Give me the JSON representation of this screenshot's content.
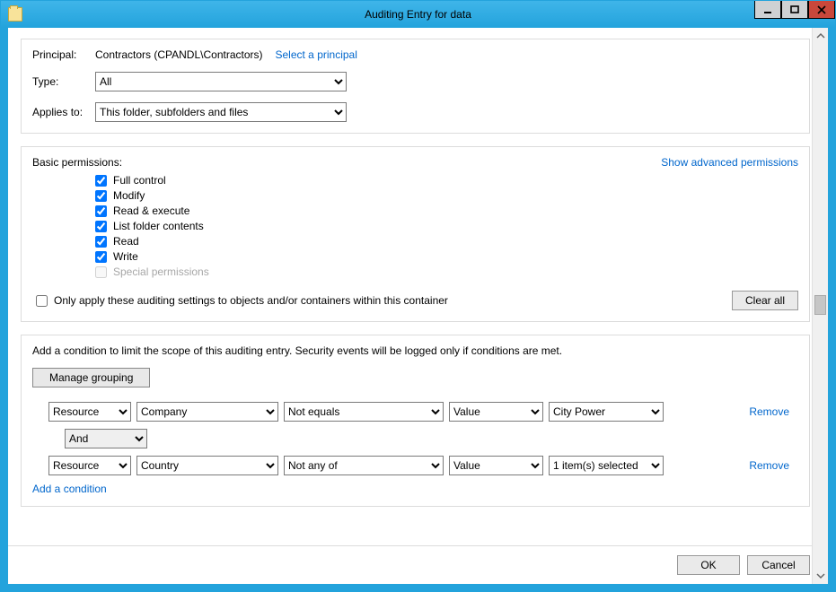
{
  "window": {
    "title": "Auditing Entry for data"
  },
  "principal": {
    "label": "Principal:",
    "value": "Contractors (CPANDL\\Contractors)",
    "select_link": "Select a principal"
  },
  "type": {
    "label": "Type:",
    "selected": "All"
  },
  "applies_to": {
    "label": "Applies to:",
    "selected": "This folder, subfolders and files"
  },
  "permissions": {
    "heading": "Basic permissions:",
    "advanced_link": "Show advanced permissions",
    "items": [
      {
        "label": "Full control",
        "checked": true,
        "disabled": false
      },
      {
        "label": "Modify",
        "checked": true,
        "disabled": false
      },
      {
        "label": "Read & execute",
        "checked": true,
        "disabled": false
      },
      {
        "label": "List folder contents",
        "checked": true,
        "disabled": false
      },
      {
        "label": "Read",
        "checked": true,
        "disabled": false
      },
      {
        "label": "Write",
        "checked": true,
        "disabled": false
      },
      {
        "label": "Special permissions",
        "checked": false,
        "disabled": true
      }
    ],
    "only_within_container": "Only apply these auditing settings to objects and/or containers within this container",
    "clear_all": "Clear all"
  },
  "conditions": {
    "heading": "Add a condition to limit the scope of this auditing entry. Security events will be logged only if conditions are met.",
    "manage_grouping": "Manage grouping",
    "rows": [
      {
        "subject": "Resource",
        "attribute": "Company",
        "operator": "Not equals",
        "value_type": "Value",
        "value": "City Power"
      },
      {
        "connector": "And"
      },
      {
        "subject": "Resource",
        "attribute": "Country",
        "operator": "Not any of",
        "value_type": "Value",
        "value": "1 item(s) selected"
      }
    ],
    "remove": "Remove",
    "add_condition": "Add a condition"
  },
  "footer": {
    "ok": "OK",
    "cancel": "Cancel"
  }
}
